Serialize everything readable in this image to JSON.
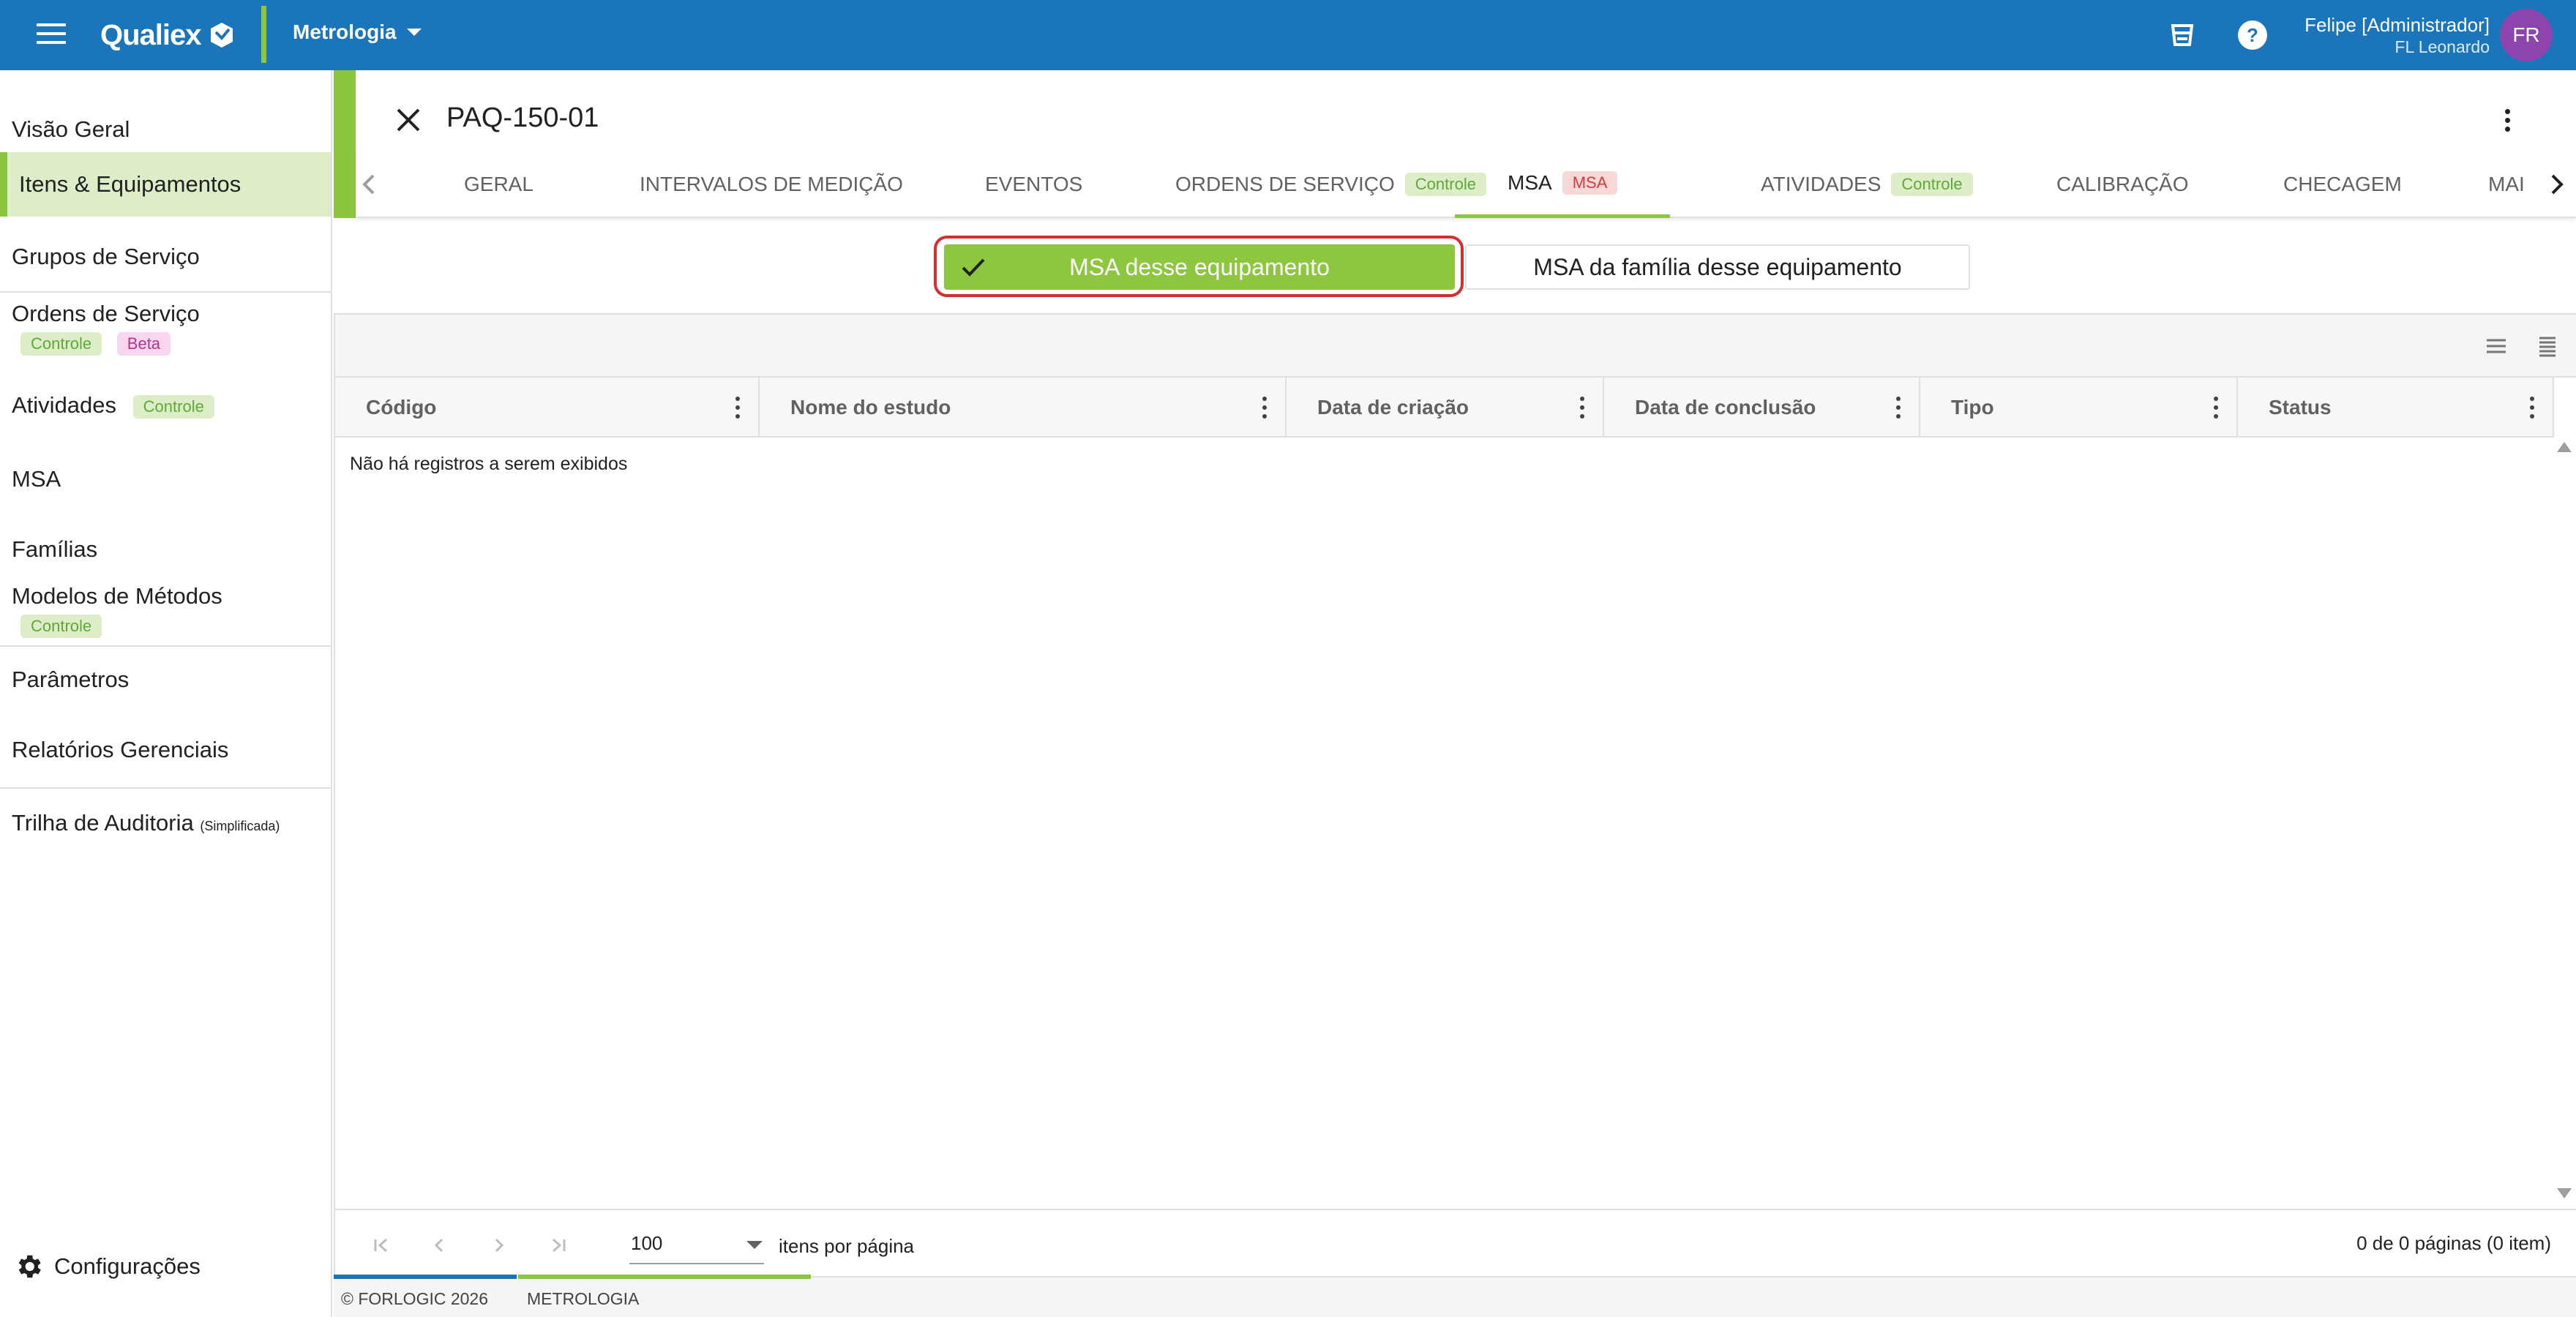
{
  "topbar": {
    "logo_text": "Qualiex",
    "module": "Metrologia",
    "user_name": "Felipe [Administrador]",
    "user_company": "FL Leonardo",
    "avatar_initials": "FR",
    "icons": [
      "hamburger-icon",
      "coffee-cup-icon",
      "help-icon"
    ],
    "colors": {
      "bar": "#1b75bb",
      "accent": "#8cc63f",
      "avatar": "#8e44ad"
    }
  },
  "sidebar": {
    "items": [
      {
        "label": "Visão Geral"
      },
      {
        "label": "Itens & Equipamentos",
        "active": true
      },
      {
        "label": "Grupos de Serviço"
      },
      {
        "label": "Ordens de Serviço",
        "badges": [
          "Controle",
          "Beta"
        ]
      },
      {
        "label": "Atividades",
        "badges": [
          "Controle"
        ]
      },
      {
        "label": "MSA"
      },
      {
        "label": "Famílias"
      },
      {
        "label": "Modelos de Métodos",
        "badges": [
          "Controle"
        ]
      },
      {
        "label": "Parâmetros"
      },
      {
        "label": "Relatórios Gerenciais"
      },
      {
        "label": "Trilha de Auditoria",
        "note": "(Simplificada)"
      }
    ],
    "config_label": "Configurações"
  },
  "record": {
    "title": "PAQ-150-01"
  },
  "tabs": [
    {
      "label": "GERAL"
    },
    {
      "label": "INTERVALOS DE MEDIÇÃO"
    },
    {
      "label": "EVENTOS"
    },
    {
      "label": "ORDENS DE SERVIÇO",
      "badge": "Controle"
    },
    {
      "label": "MSA",
      "badge": "MSA",
      "active": true
    },
    {
      "label": "ATIVIDADES",
      "badge": "Controle"
    },
    {
      "label": "CALIBRAÇÃO"
    },
    {
      "label": "CHECAGEM"
    },
    {
      "label": "MAI"
    }
  ],
  "toggle": {
    "selected": "MSA desse equipamento",
    "other": "MSA da família desse equipamento"
  },
  "grid": {
    "columns": [
      "Código",
      "Nome do estudo",
      "Data de criação",
      "Data de conclusão",
      "Tipo",
      "Status"
    ],
    "empty_message": "Não há registros a serem exibidos",
    "page_size": "100",
    "page_size_label": "itens por página",
    "page_info": "0 de 0 páginas (0 item)"
  },
  "footer": {
    "copyright": "© FORLOGIC 2026",
    "module": "METROLOGIA"
  }
}
